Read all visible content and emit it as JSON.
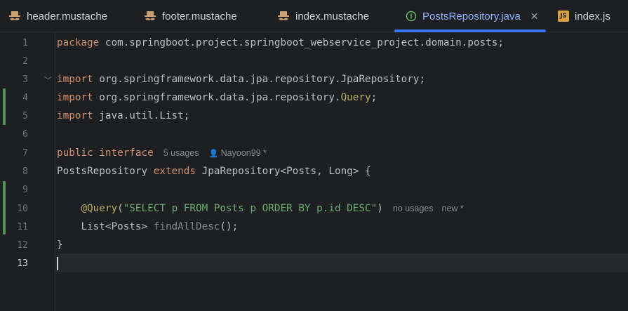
{
  "tabs": [
    {
      "label": "header.mustache",
      "icon": "mustache-icon",
      "active": false
    },
    {
      "label": "footer.mustache",
      "icon": "mustache-icon",
      "active": false
    },
    {
      "label": "index.mustache",
      "icon": "mustache-icon",
      "active": false
    },
    {
      "label": "PostsRepository.java",
      "icon": "java-interface-icon",
      "active": true,
      "close": "✕"
    },
    {
      "label": "index.js",
      "icon": "js-icon",
      "active": false,
      "badge": "JS"
    }
  ],
  "editor": {
    "line_numbers": [
      "1",
      "2",
      "3",
      "4",
      "5",
      "6",
      "7",
      "8",
      "9",
      "10",
      "11",
      "12",
      "13"
    ],
    "line1": {
      "kw": "package",
      "rest": " com.springboot.project.springboot_webservice_project.domain.posts;"
    },
    "line3": {
      "kw": "import",
      "rest": " org.springframework.data.jpa.repository.JpaRepository;"
    },
    "line4": {
      "kw": "import",
      "rest": " org.springframework.data.jpa.repository.",
      "ann": "Query",
      "end": ";"
    },
    "line5": {
      "kw": "import",
      "rest": " java.util.List;"
    },
    "line7": {
      "kw1": "public",
      "kw2": "interface",
      "usages": "5 usages",
      "author": "Nayoon99 *"
    },
    "line8": {
      "name": "PostsRepository ",
      "kw": "extends",
      "rest": " JpaRepository<Posts, Long> {"
    },
    "line10": {
      "ann": "@Query",
      "open": "(",
      "str": "\"SELECT p FROM Posts p ORDER BY p.id DESC\"",
      "close": ")",
      "usages": "no usages",
      "status": "new *"
    },
    "line11": {
      "type": "List<Posts> ",
      "method": "findAllDesc",
      "end": "();"
    },
    "line12": {
      "brace": "}"
    }
  }
}
